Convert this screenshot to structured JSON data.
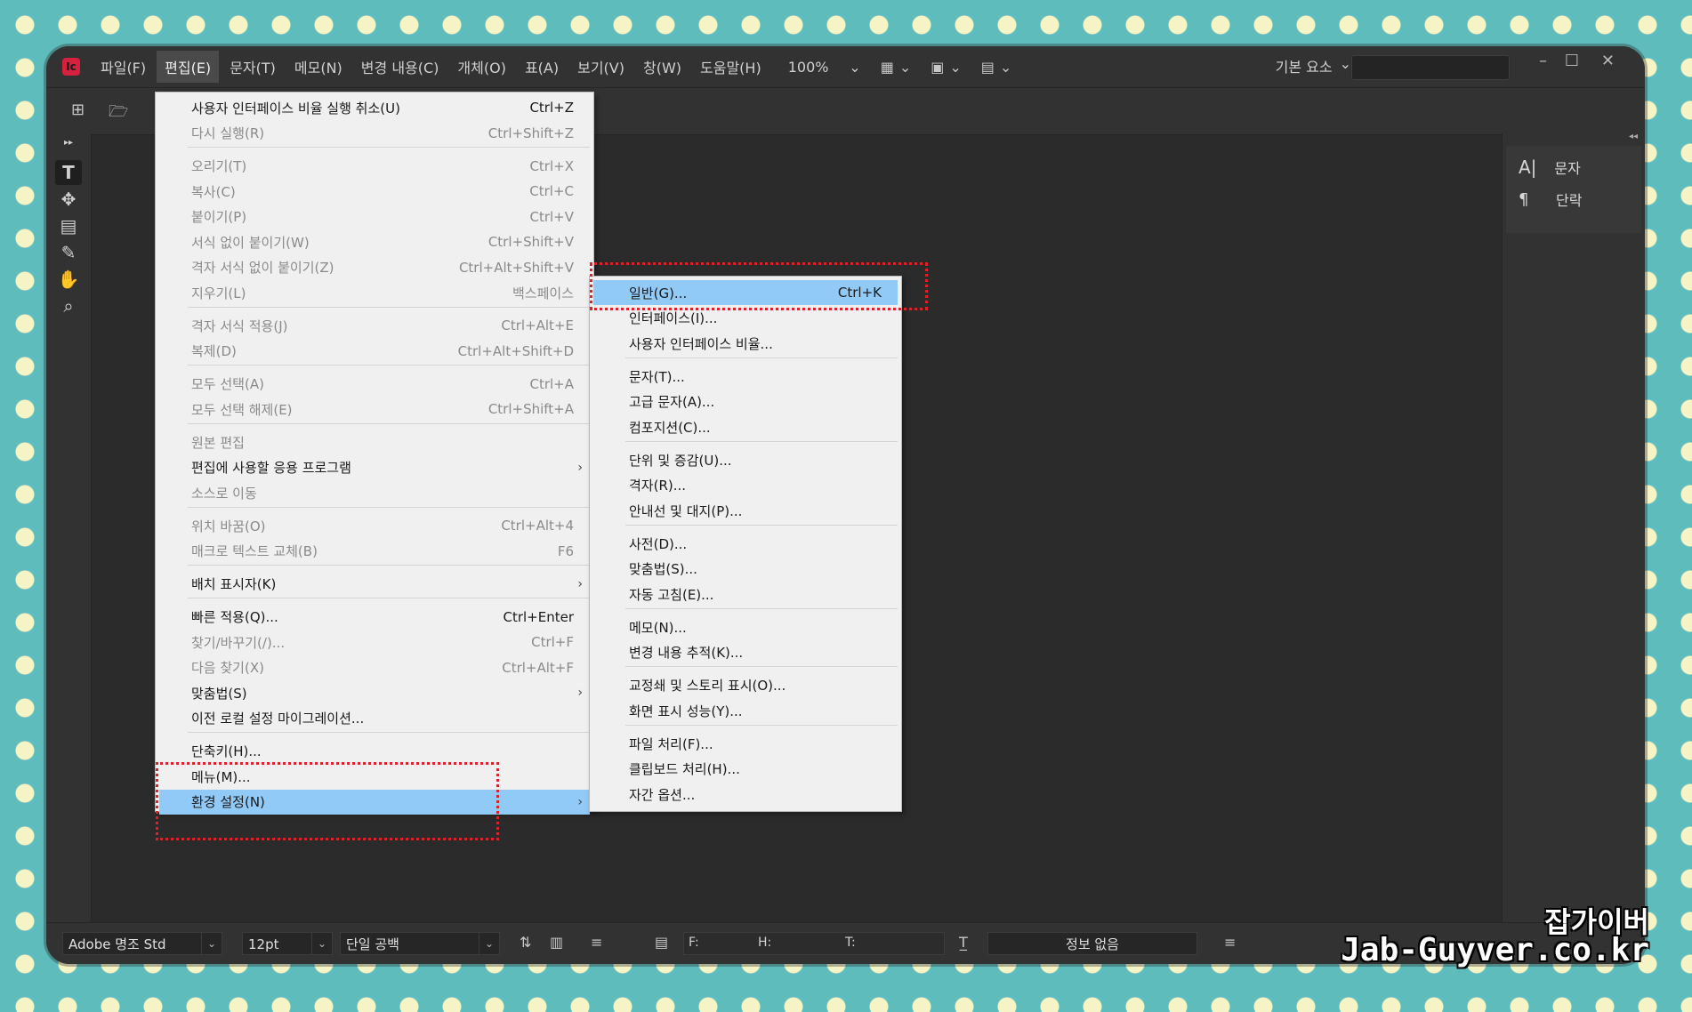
{
  "app": {
    "logo_text": "Ic",
    "menubar": [
      "파일(F)",
      "편집(E)",
      "문자(T)",
      "메모(N)",
      "변경 내용(C)",
      "개체(O)",
      "표(A)",
      "보기(V)",
      "창(W)",
      "도움말(H)"
    ],
    "zoom": "100%",
    "workspace": "기본 요소",
    "search_placeholder": ""
  },
  "edit_menu": {
    "items": [
      {
        "label": "사용자 인터페이스 비율 실행 취소(U)",
        "shortcut": "Ctrl+Z",
        "enabled": true
      },
      {
        "label": "다시 실행(R)",
        "shortcut": "Ctrl+Shift+Z",
        "enabled": false
      },
      {
        "label": "오리기(T)",
        "shortcut": "Ctrl+X",
        "enabled": false
      },
      {
        "label": "복사(C)",
        "shortcut": "Ctrl+C",
        "enabled": false
      },
      {
        "label": "붙이기(P)",
        "shortcut": "Ctrl+V",
        "enabled": false
      },
      {
        "label": "서식 없이 붙이기(W)",
        "shortcut": "Ctrl+Shift+V",
        "enabled": false
      },
      {
        "label": "격자 서식 없이 붙이기(Z)",
        "shortcut": "Ctrl+Alt+Shift+V",
        "enabled": false
      },
      {
        "label": "지우기(L)",
        "shortcut": "백스페이스",
        "enabled": false
      },
      {
        "label": "격자 서식 적용(J)",
        "shortcut": "Ctrl+Alt+E",
        "enabled": false
      },
      {
        "label": "복제(D)",
        "shortcut": "Ctrl+Alt+Shift+D",
        "enabled": false
      },
      {
        "label": "모두 선택(A)",
        "shortcut": "Ctrl+A",
        "enabled": false
      },
      {
        "label": "모두 선택 해제(E)",
        "shortcut": "Ctrl+Shift+A",
        "enabled": false
      },
      {
        "label": "원본 편집",
        "shortcut": "",
        "enabled": false
      },
      {
        "label": "편집에 사용할 응용 프로그램",
        "shortcut": "",
        "enabled": true,
        "submenu": true
      },
      {
        "label": "소스로 이동",
        "shortcut": "",
        "enabled": false
      },
      {
        "label": "위치 바꿈(O)",
        "shortcut": "Ctrl+Alt+4",
        "enabled": false
      },
      {
        "label": "매크로 텍스트 교체(B)",
        "shortcut": "F6",
        "enabled": false
      },
      {
        "label": "배치 표시자(K)",
        "shortcut": "",
        "enabled": true,
        "submenu": true
      },
      {
        "label": "빠른 적용(Q)...",
        "shortcut": "Ctrl+Enter",
        "enabled": true
      },
      {
        "label": "찾기/바꾸기(/)...",
        "shortcut": "Ctrl+F",
        "enabled": false
      },
      {
        "label": "다음 찾기(X)",
        "shortcut": "Ctrl+Alt+F",
        "enabled": false
      },
      {
        "label": "맞춤법(S)",
        "shortcut": "",
        "enabled": true,
        "submenu": true
      },
      {
        "label": "이전 로컬 설정 마이그레이션...",
        "shortcut": "",
        "enabled": true
      },
      {
        "label": "단축키(H)...",
        "shortcut": "",
        "enabled": true
      },
      {
        "label": "메뉴(M)...",
        "shortcut": "",
        "enabled": true
      },
      {
        "label": "환경 설정(N)",
        "shortcut": "",
        "enabled": true,
        "submenu": true,
        "highlighted": true
      }
    ]
  },
  "pref_menu": {
    "items": [
      {
        "label": "일반(G)...",
        "shortcut": "Ctrl+K",
        "highlighted": true
      },
      {
        "label": "인터페이스(I)...",
        "shortcut": ""
      },
      {
        "label": "사용자 인터페이스 비율...",
        "shortcut": ""
      },
      {
        "label": "문자(T)...",
        "shortcut": ""
      },
      {
        "label": "고급 문자(A)...",
        "shortcut": ""
      },
      {
        "label": "컴포지션(C)...",
        "shortcut": ""
      },
      {
        "label": "단위 및 증감(U)...",
        "shortcut": ""
      },
      {
        "label": "격자(R)...",
        "shortcut": ""
      },
      {
        "label": "안내선 및 대지(P)...",
        "shortcut": ""
      },
      {
        "label": "사전(D)...",
        "shortcut": ""
      },
      {
        "label": "맞춤법(S)...",
        "shortcut": ""
      },
      {
        "label": "자동 고침(E)...",
        "shortcut": ""
      },
      {
        "label": "메모(N)...",
        "shortcut": ""
      },
      {
        "label": "변경 내용 추적(K)...",
        "shortcut": ""
      },
      {
        "label": "교정쇄 및 스토리 표시(O)...",
        "shortcut": ""
      },
      {
        "label": "화면 표시 성능(Y)...",
        "shortcut": ""
      },
      {
        "label": "파일 처리(F)...",
        "shortcut": ""
      },
      {
        "label": "클립보드 처리(H)...",
        "shortcut": ""
      },
      {
        "label": "자간 옵션...",
        "shortcut": ""
      }
    ]
  },
  "right_panel": {
    "items": [
      {
        "label": "문자",
        "icon": "character-panel-icon"
      },
      {
        "label": "단락",
        "icon": "paragraph-panel-icon"
      }
    ]
  },
  "status": {
    "font": "Adobe 명조 Std",
    "size": "12pt",
    "spacing": "단일 공백",
    "f_label": "F:",
    "h_label": "H:",
    "t_label": "T:",
    "info": "정보 없음"
  },
  "watermark": {
    "line1": "잡가이버",
    "line2": "Jab-Guyver.co.kr"
  },
  "colors": {
    "menu_highlight": "#91c9f7",
    "annotation": "#e0202a",
    "background_teal": "#5fbcbc",
    "polka_dot": "#f6f3c4"
  }
}
